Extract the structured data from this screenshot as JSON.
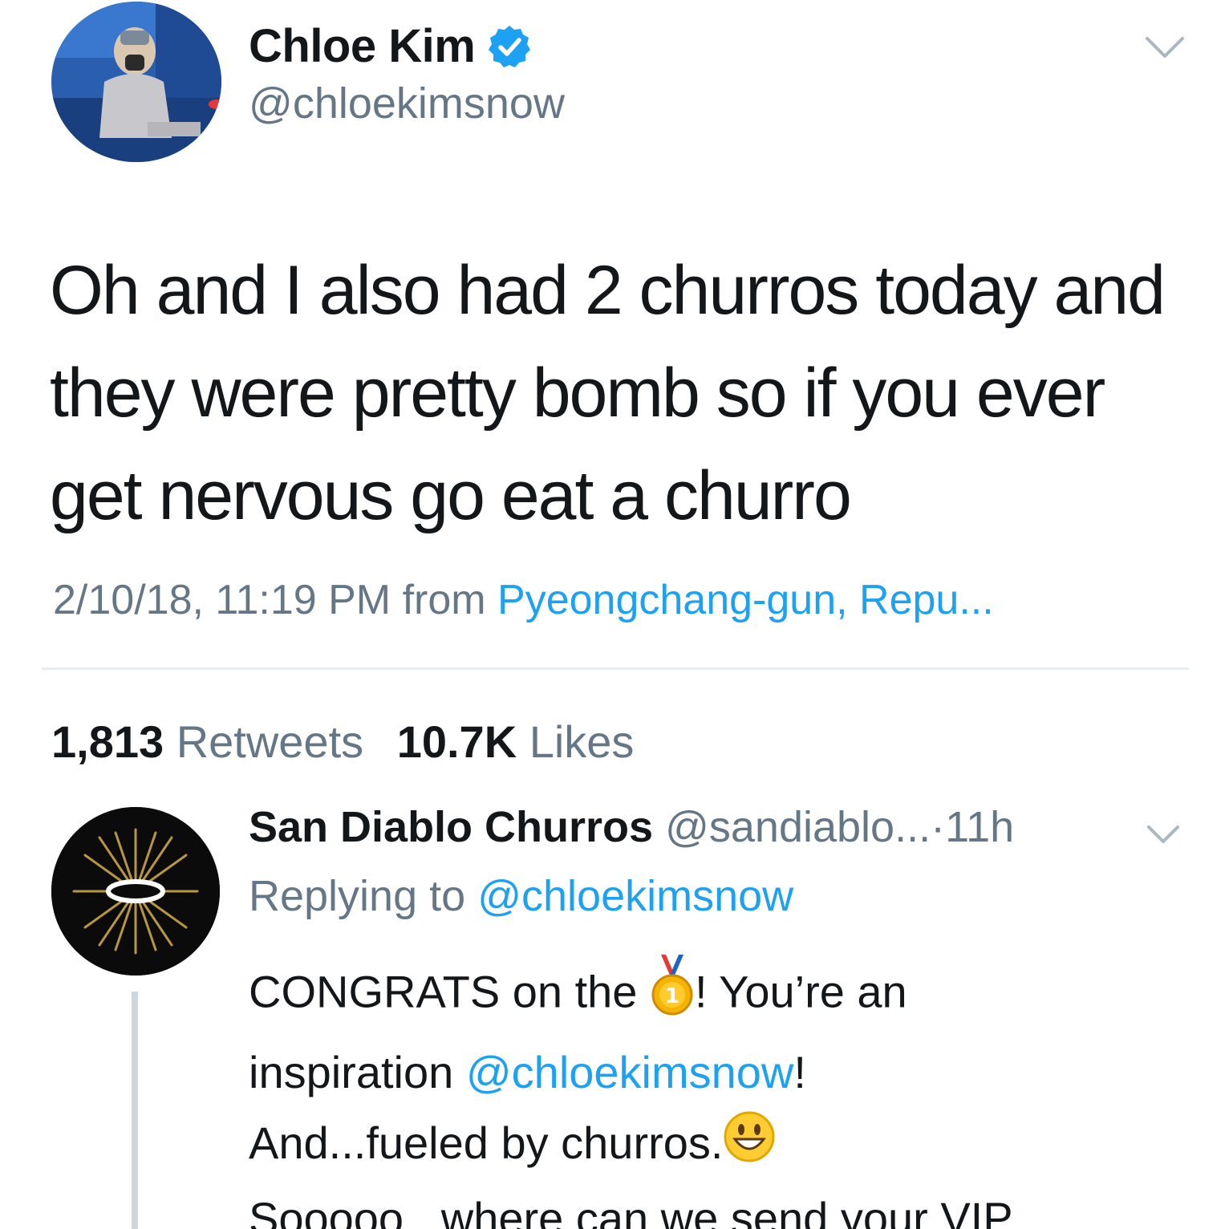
{
  "tweet": {
    "author_name": "Chloe Kim",
    "author_handle": "@chloekimsnow",
    "text": "Oh and I also had 2 churros today and they were pretty bomb so if you ever get nervous go eat a churro",
    "timestamp": "2/10/18, 11:19 PM",
    "from_label": "from",
    "location": "Pyeongchang-gun, Repu...",
    "retweets_count": "1,813",
    "retweets_label": "Retweets",
    "likes_count": "10.7K",
    "likes_label": "Likes"
  },
  "reply": {
    "author_name": "San Diablo Churros",
    "author_handle": "@sandiablo...",
    "separator": "·",
    "time": "11h",
    "replying_label": "Replying to",
    "replying_to": "@chloekimsnow",
    "line1_before": "CONGRATS on the",
    "line1_after": "! You’re an",
    "line2_before": "inspiration",
    "line2_mention": "@chloekimsnow",
    "line2_after": "!",
    "line3": "And...fueled by churros.",
    "line4": "Sooooo...where can we send your VIP"
  },
  "icons": {
    "verified": "verified-badge-icon",
    "caret": "chevron-down-icon",
    "medal": "gold-medal-emoji",
    "smiley": "smiley-emoji"
  },
  "colors": {
    "link": "#1da1f2",
    "secondary_text": "#657786",
    "primary_text": "#14171a",
    "divider": "#e6ecf0",
    "thread_line": "#ccd6dd"
  }
}
